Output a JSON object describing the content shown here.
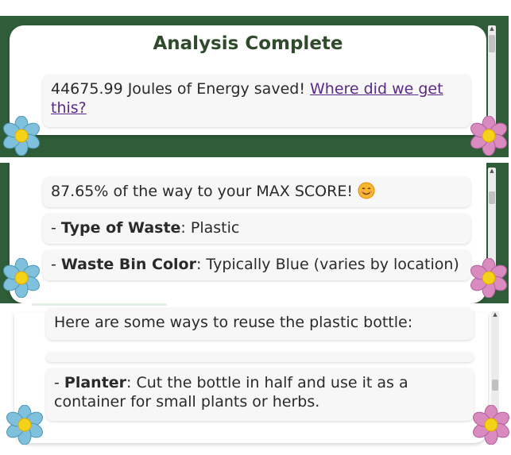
{
  "panel1": {
    "title": "Analysis Complete",
    "energy_text": "44675.99 Joules of Energy saved! ",
    "energy_link": "Where did we get this?"
  },
  "panel2": {
    "score_text": "87.65% of the way to your MAX SCORE!",
    "score_emoji": "smiling-face-emoji",
    "waste_type_label": "Type of Waste",
    "waste_type_value": ": Plastic",
    "bin_color_label": "Waste Bin Color",
    "bin_color_value": ": Typically Blue (varies by location)"
  },
  "panel3": {
    "intro_text": "Here are some ways to reuse the plastic bottle:",
    "planter_label": "Planter",
    "planter_value": ": Cut the bottle in half and use it as a container for small plants or herbs."
  },
  "bullet_prefix": "- ",
  "colors": {
    "frame_green": "#2f5d38",
    "title_green": "#2f4b2c",
    "link_purple": "#5b2a86",
    "bubble_bg": "#f7f7f7",
    "flower_blue": "#7fc1dc",
    "flower_pink": "#d98bc0",
    "flower_center": "#f5d21a"
  },
  "icons": {
    "left_flower": "blue-flower-icon",
    "right_flower": "pink-flower-icon"
  }
}
